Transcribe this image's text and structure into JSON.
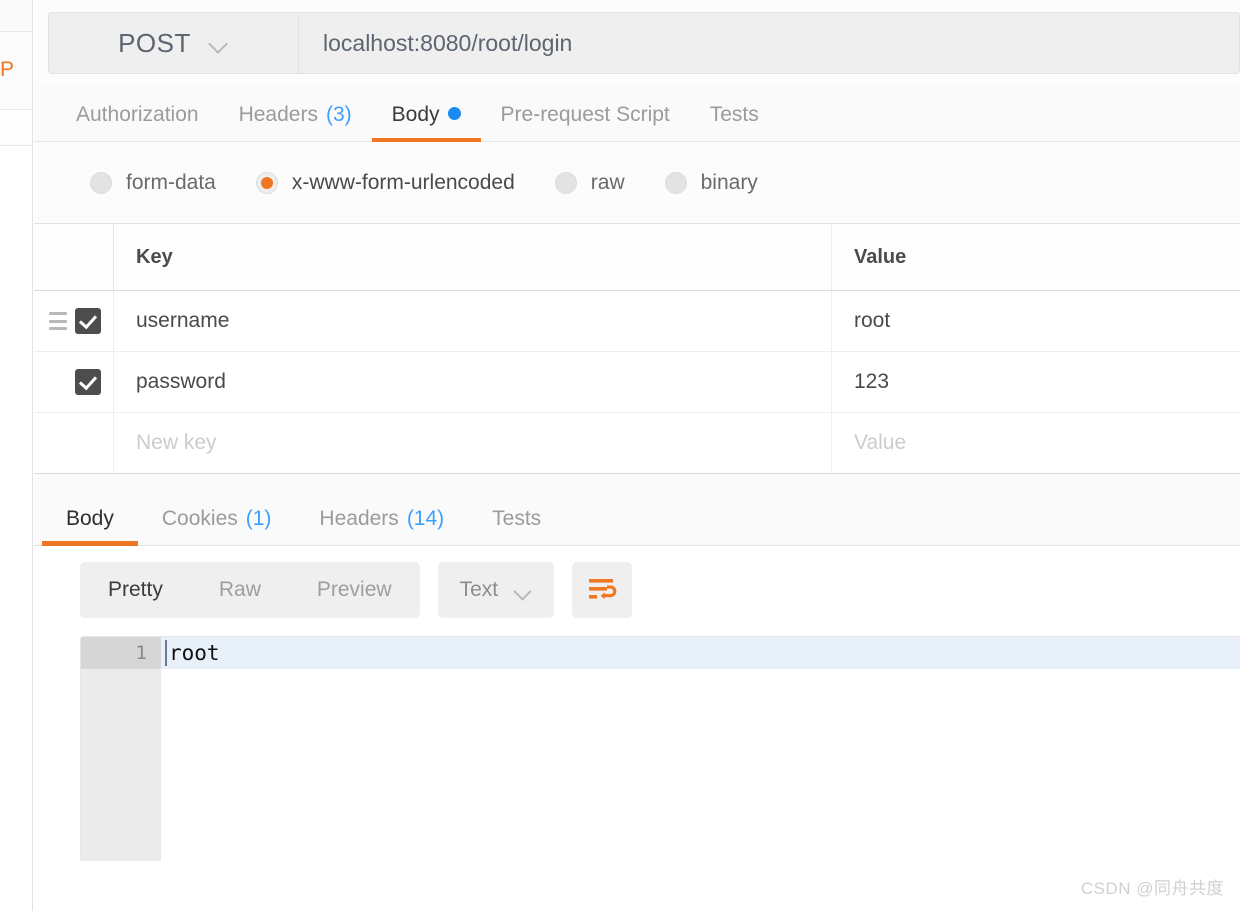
{
  "left_rail": {
    "method_fragment": "PUT"
  },
  "request": {
    "method": "POST",
    "method_caret_icon": "chevron-down-icon",
    "url": "localhost:8080/root/login",
    "tabs": [
      {
        "label": "Authorization",
        "count": "",
        "active": false,
        "dot": false
      },
      {
        "label": "Headers",
        "count": "(3)",
        "active": false,
        "dot": false
      },
      {
        "label": "Body",
        "count": "",
        "active": true,
        "dot": true
      },
      {
        "label": "Pre-request Script",
        "count": "",
        "active": false,
        "dot": false
      },
      {
        "label": "Tests",
        "count": "",
        "active": false,
        "dot": false
      }
    ],
    "body_types": [
      {
        "label": "form-data",
        "selected": false
      },
      {
        "label": "x-www-form-urlencoded",
        "selected": true
      },
      {
        "label": "raw",
        "selected": false
      },
      {
        "label": "binary",
        "selected": false
      }
    ],
    "table": {
      "headers": {
        "key": "Key",
        "value": "Value"
      },
      "rows": [
        {
          "checked": true,
          "handle": true,
          "key": "username",
          "value": "root"
        },
        {
          "checked": true,
          "handle": false,
          "key": "password",
          "value": "123"
        }
      ],
      "new_row": {
        "key_placeholder": "New key",
        "value_placeholder": "Value"
      }
    }
  },
  "response": {
    "tabs": [
      {
        "label": "Body",
        "count": "",
        "active": true
      },
      {
        "label": "Cookies",
        "count": "(1)",
        "active": false
      },
      {
        "label": "Headers",
        "count": "(14)",
        "active": false
      },
      {
        "label": "Tests",
        "count": "",
        "active": false
      }
    ],
    "view_modes": [
      {
        "label": "Pretty",
        "active": true
      },
      {
        "label": "Raw",
        "active": false
      },
      {
        "label": "Preview",
        "active": false
      }
    ],
    "format": {
      "label": "Text",
      "caret_icon": "chevron-down-icon"
    },
    "wrap_button_icon": "word-wrap-icon",
    "code": {
      "lines": [
        {
          "number": "1",
          "text": "root",
          "active": true
        }
      ]
    }
  },
  "watermark": "CSDN @同舟共度",
  "colors": {
    "accent_orange": "#ef7622",
    "link_blue": "#3ba0ff",
    "dot_blue": "#1a8cf0",
    "checkbox_dark": "#4d4d4d",
    "active_line": "#e8f0fa"
  }
}
